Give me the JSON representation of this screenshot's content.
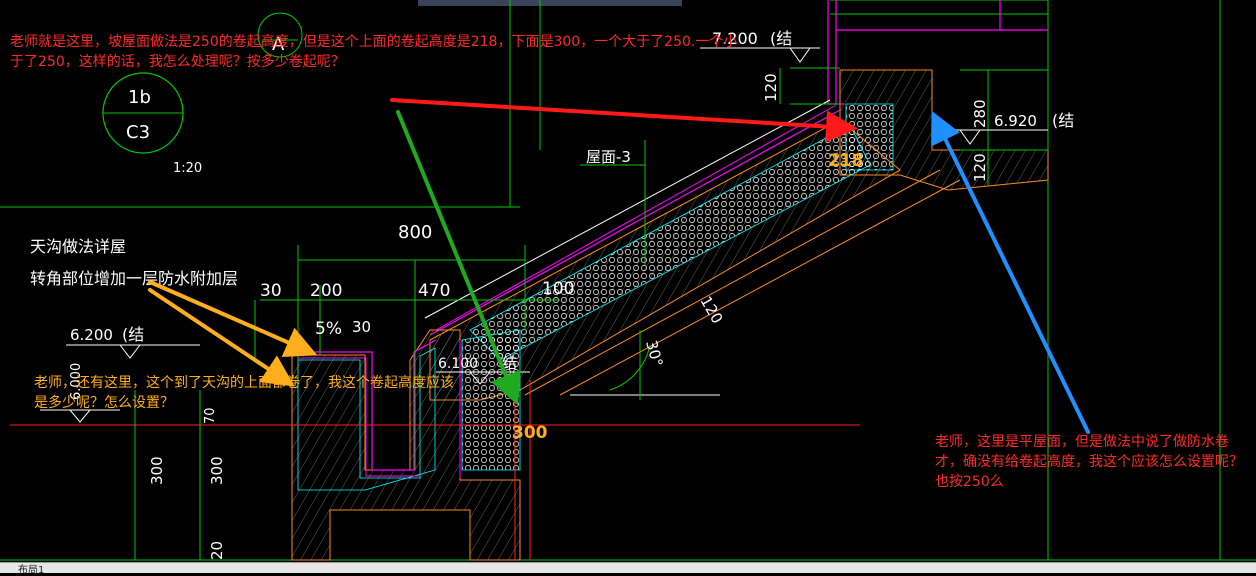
{
  "colors": {
    "background": "#000000",
    "cad_green": "#00c800",
    "cad_white": "#ffffff",
    "cad_magenta": "#ff00ff",
    "cad_cyan": "#00ffff",
    "cad_red": "#ff2020",
    "cad_orange": "#ff8a1e",
    "annotation_red": "#ff2a2a",
    "annotation_orange": "#ffae1e",
    "arrow_red": "#ff1a1a",
    "arrow_green": "#1faa1f",
    "arrow_orange": "#ffae1e",
    "arrow_blue": "#1e90ff"
  },
  "drawing": {
    "circle_top_letter": "A",
    "section_circle_top": "1b",
    "section_circle_bottom": "C3",
    "scale": "1:20",
    "gutter_title": "天沟做法详屋",
    "gutter_note": "转角部位增加一层防水附加层",
    "roof_label": "屋面-3",
    "dim_800": "800",
    "dim_30": "30",
    "dim_200": "200",
    "dim_470": "470",
    "dim_100": "100",
    "dim_slope_pct": "5%",
    "dim_30b": "30",
    "dim_120a": "120",
    "dim_120b": "120",
    "dim_120c": "120",
    "dim_280": "280",
    "dim_300a": "300",
    "dim_300b": "300",
    "dim_20": "20",
    "dim_70": "70",
    "angle": "30°",
    "elev_7200": "7.200",
    "elev_7200_suffix": "(结",
    "elev_6920": "6.920",
    "elev_6920_suffix": "(结",
    "elev_6200": "6.200",
    "elev_6200_suffix": "(结",
    "elev_6100": "6.100",
    "elev_6100_suffix": "结",
    "elev_6000": "6.000",
    "value_218": "218",
    "value_300": "300"
  },
  "annotations": {
    "top_left": "老师就是这里，坡屋面做法是250的卷起高度，但是这个上面的卷起高度是218，下面是300，一个大于了250.一个小于了250，这样的话，我怎么处理呢？按多少卷起呢？",
    "left_middle": "老师，还有这里，这个到了天沟的上面都卷了，我这个卷起高度应该是多少呢？怎么设置？",
    "right": "老师，这里是平屋面，但是做法中说了做防水卷才，确没有给卷起高度，我这个应该怎么设置呢？也按250么"
  },
  "tab": {
    "label": "布局1"
  }
}
